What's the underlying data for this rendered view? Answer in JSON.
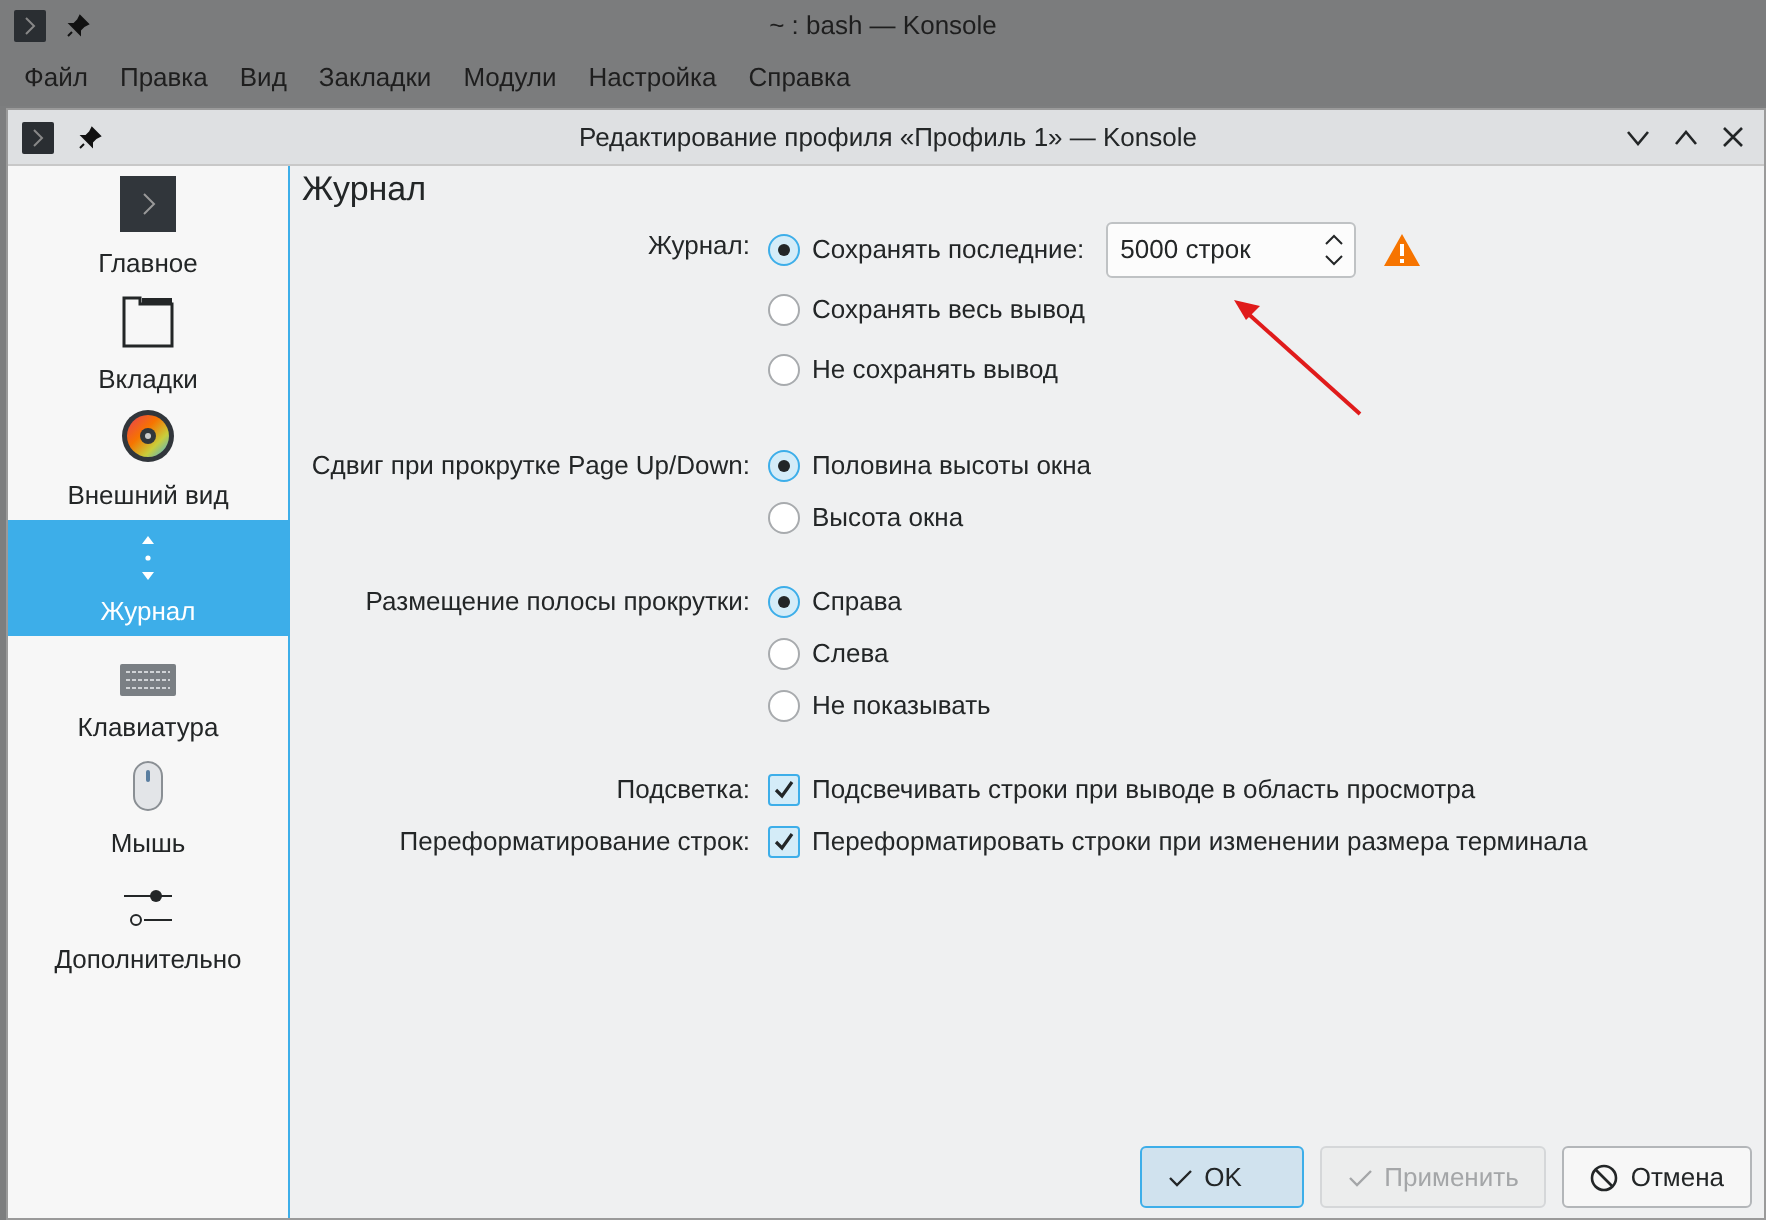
{
  "background_window": {
    "title": "~ : bash — Konsole",
    "menu": [
      "Файл",
      "Правка",
      "Вид",
      "Закладки",
      "Модули",
      "Настройка",
      "Справка"
    ]
  },
  "dialog": {
    "title": "Редактирование профиля «Профиль 1» — Konsole",
    "sidebar": [
      {
        "label": "Главное",
        "selected": false
      },
      {
        "label": "Вкладки",
        "selected": false
      },
      {
        "label": "Внешний вид",
        "selected": false
      },
      {
        "label": "Журнал",
        "selected": true
      },
      {
        "label": "Клавиатура",
        "selected": false
      },
      {
        "label": "Мышь",
        "selected": false
      },
      {
        "label": "Дополнительно",
        "selected": false
      }
    ],
    "heading": "Журнал",
    "groups": [
      {
        "kind": "radio",
        "label": "Журнал:",
        "options": [
          {
            "label": "Сохранять последние:",
            "selected": true,
            "spinbox": "5000 строк",
            "warning": true
          },
          {
            "label": "Сохранять весь вывод",
            "selected": false
          },
          {
            "label": "Не сохранять вывод",
            "selected": false
          }
        ]
      },
      {
        "kind": "radio",
        "label": "Сдвиг при прокрутке Page Up/Down:",
        "options": [
          {
            "label": "Половина высоты окна",
            "selected": true
          },
          {
            "label": "Высота окна",
            "selected": false
          }
        ]
      },
      {
        "kind": "radio",
        "label": "Размещение полосы прокрутки:",
        "options": [
          {
            "label": "Справа",
            "selected": true
          },
          {
            "label": "Слева",
            "selected": false
          },
          {
            "label": "Не показывать",
            "selected": false
          }
        ]
      },
      {
        "kind": "checkbox",
        "label": "Подсветка:",
        "options": [
          {
            "label": "Подсвечивать строки при выводе в область просмотра",
            "checked": true
          }
        ]
      },
      {
        "kind": "checkbox",
        "label": "Переформатирование строк:",
        "options": [
          {
            "label": "Переформатировать строки при изменении размера терминала",
            "checked": true
          }
        ]
      }
    ],
    "buttons": [
      {
        "label": "OK",
        "kind": "ok",
        "default": true,
        "disabled": false
      },
      {
        "label": "Применить",
        "kind": "apply",
        "default": false,
        "disabled": true
      },
      {
        "label": "Отмена",
        "kind": "cancel",
        "default": false,
        "disabled": false
      }
    ]
  }
}
